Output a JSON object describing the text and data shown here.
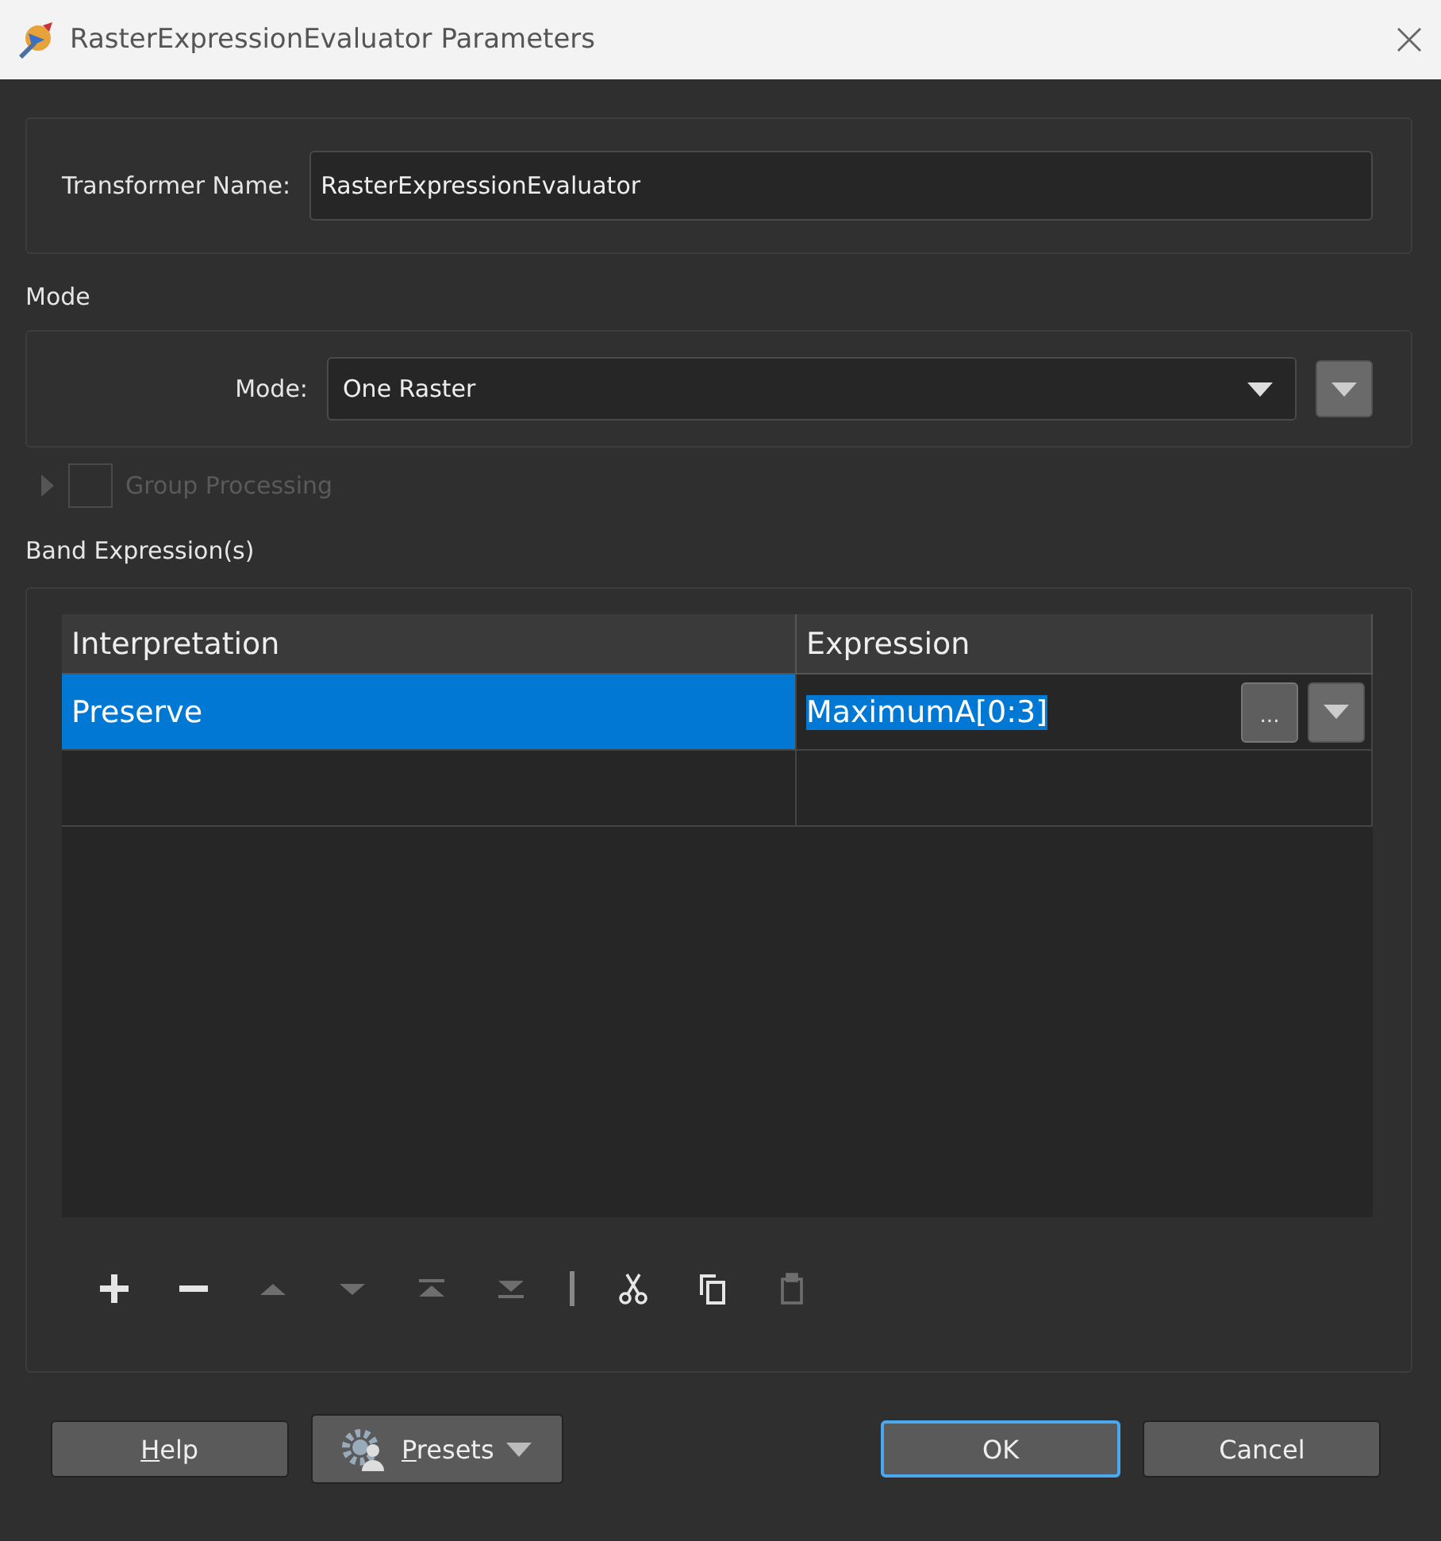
{
  "window": {
    "title": "RasterExpressionEvaluator Parameters"
  },
  "transformer_name": {
    "label": "Transformer Name:",
    "value": "RasterExpressionEvaluator"
  },
  "mode_section": {
    "title": "Mode",
    "label": "Mode:",
    "value": "One Raster"
  },
  "group_processing": {
    "label": "Group Processing",
    "checked": false,
    "disabled": true,
    "expanded": false
  },
  "band_section": {
    "title": "Band Expression(s)"
  },
  "table": {
    "columns": [
      "Interpretation",
      "Expression"
    ],
    "rows": [
      {
        "interpretation": "Preserve",
        "expression": "MaximumA[0:3]",
        "selected": true,
        "editor_button": "..."
      }
    ]
  },
  "toolbar": [
    {
      "kind": "add",
      "disabled": false
    },
    {
      "kind": "remove",
      "disabled": false
    },
    {
      "kind": "up",
      "disabled": true
    },
    {
      "kind": "down",
      "disabled": true
    },
    {
      "kind": "top",
      "disabled": true
    },
    {
      "kind": "bottom",
      "disabled": true
    },
    {
      "kind": "separator",
      "disabled": false
    },
    {
      "kind": "cut",
      "disabled": false
    },
    {
      "kind": "copy",
      "disabled": false
    },
    {
      "kind": "paste",
      "disabled": true
    }
  ],
  "buttons": [
    {
      "kind": "help",
      "label": "Help",
      "mnemonic": true,
      "default": false
    },
    {
      "kind": "presets",
      "label": "Presets",
      "mnemonic": true,
      "default": false
    },
    {
      "kind": "ok",
      "label": "OK",
      "mnemonic": false,
      "default": true
    },
    {
      "kind": "cancel",
      "label": "Cancel",
      "mnemonic": false,
      "default": false
    }
  ]
}
